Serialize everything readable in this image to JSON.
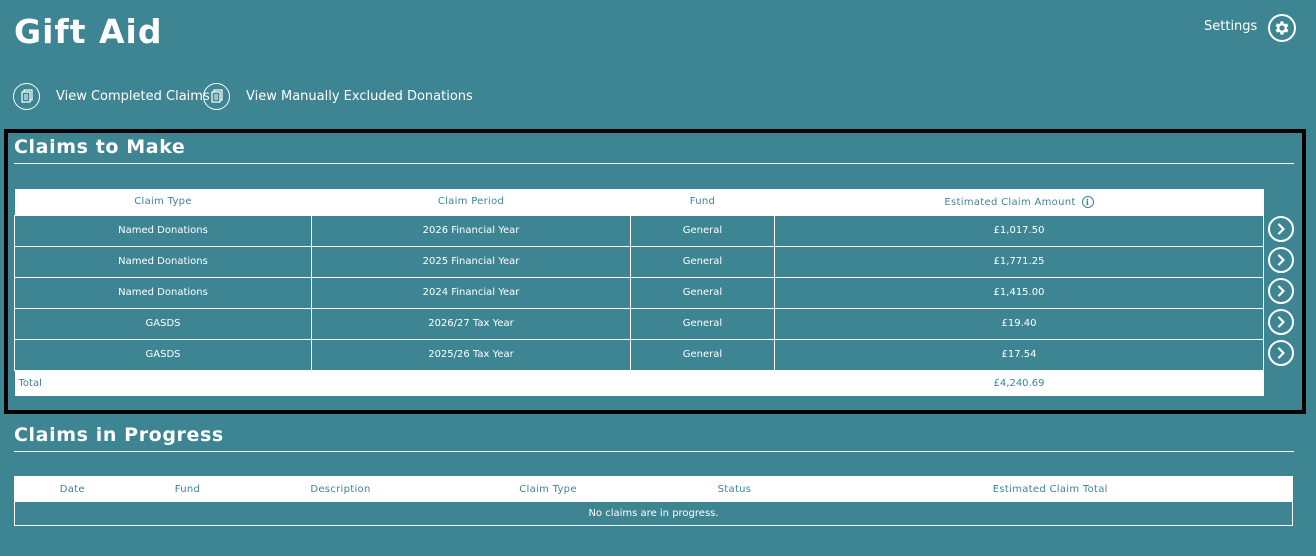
{
  "header": {
    "title": "Gift Aid",
    "settings_label": "Settings"
  },
  "actions": {
    "completed_claims": "View Completed Claims",
    "excluded_donations": "View Manually Excluded Donations"
  },
  "claims_to_make": {
    "title": "Claims to Make",
    "columns": [
      "Claim Type",
      "Claim Period",
      "Fund",
      "Estimated Claim Amount"
    ],
    "rows": [
      [
        "Named Donations",
        "2026 Financial Year",
        "General",
        "£1,017.50"
      ],
      [
        "Named Donations",
        "2025 Financial Year",
        "General",
        "£1,771.25"
      ],
      [
        "Named Donations",
        "2024 Financial Year",
        "General",
        "£1,415.00"
      ],
      [
        "GASDS",
        "2026/27 Tax Year",
        "General",
        "£19.40"
      ],
      [
        "GASDS",
        "2025/26 Tax Year",
        "General",
        "£17.54"
      ]
    ],
    "total_label": "Total",
    "total_value": "£4,240.69"
  },
  "claims_in_progress": {
    "title": "Claims in Progress",
    "columns": [
      "Date",
      "Fund",
      "Description",
      "Claim Type",
      "Status",
      "Estimated Claim Total"
    ],
    "empty_message": "No claims are in progress."
  },
  "colors": {
    "background": "#3d8593",
    "text": "#ffffff",
    "frame": "#000000"
  },
  "icons": {
    "settings": "gear-icon",
    "documents": "document-stack-icon",
    "info": "info-icon",
    "row_action": "chevron-right-icon"
  }
}
